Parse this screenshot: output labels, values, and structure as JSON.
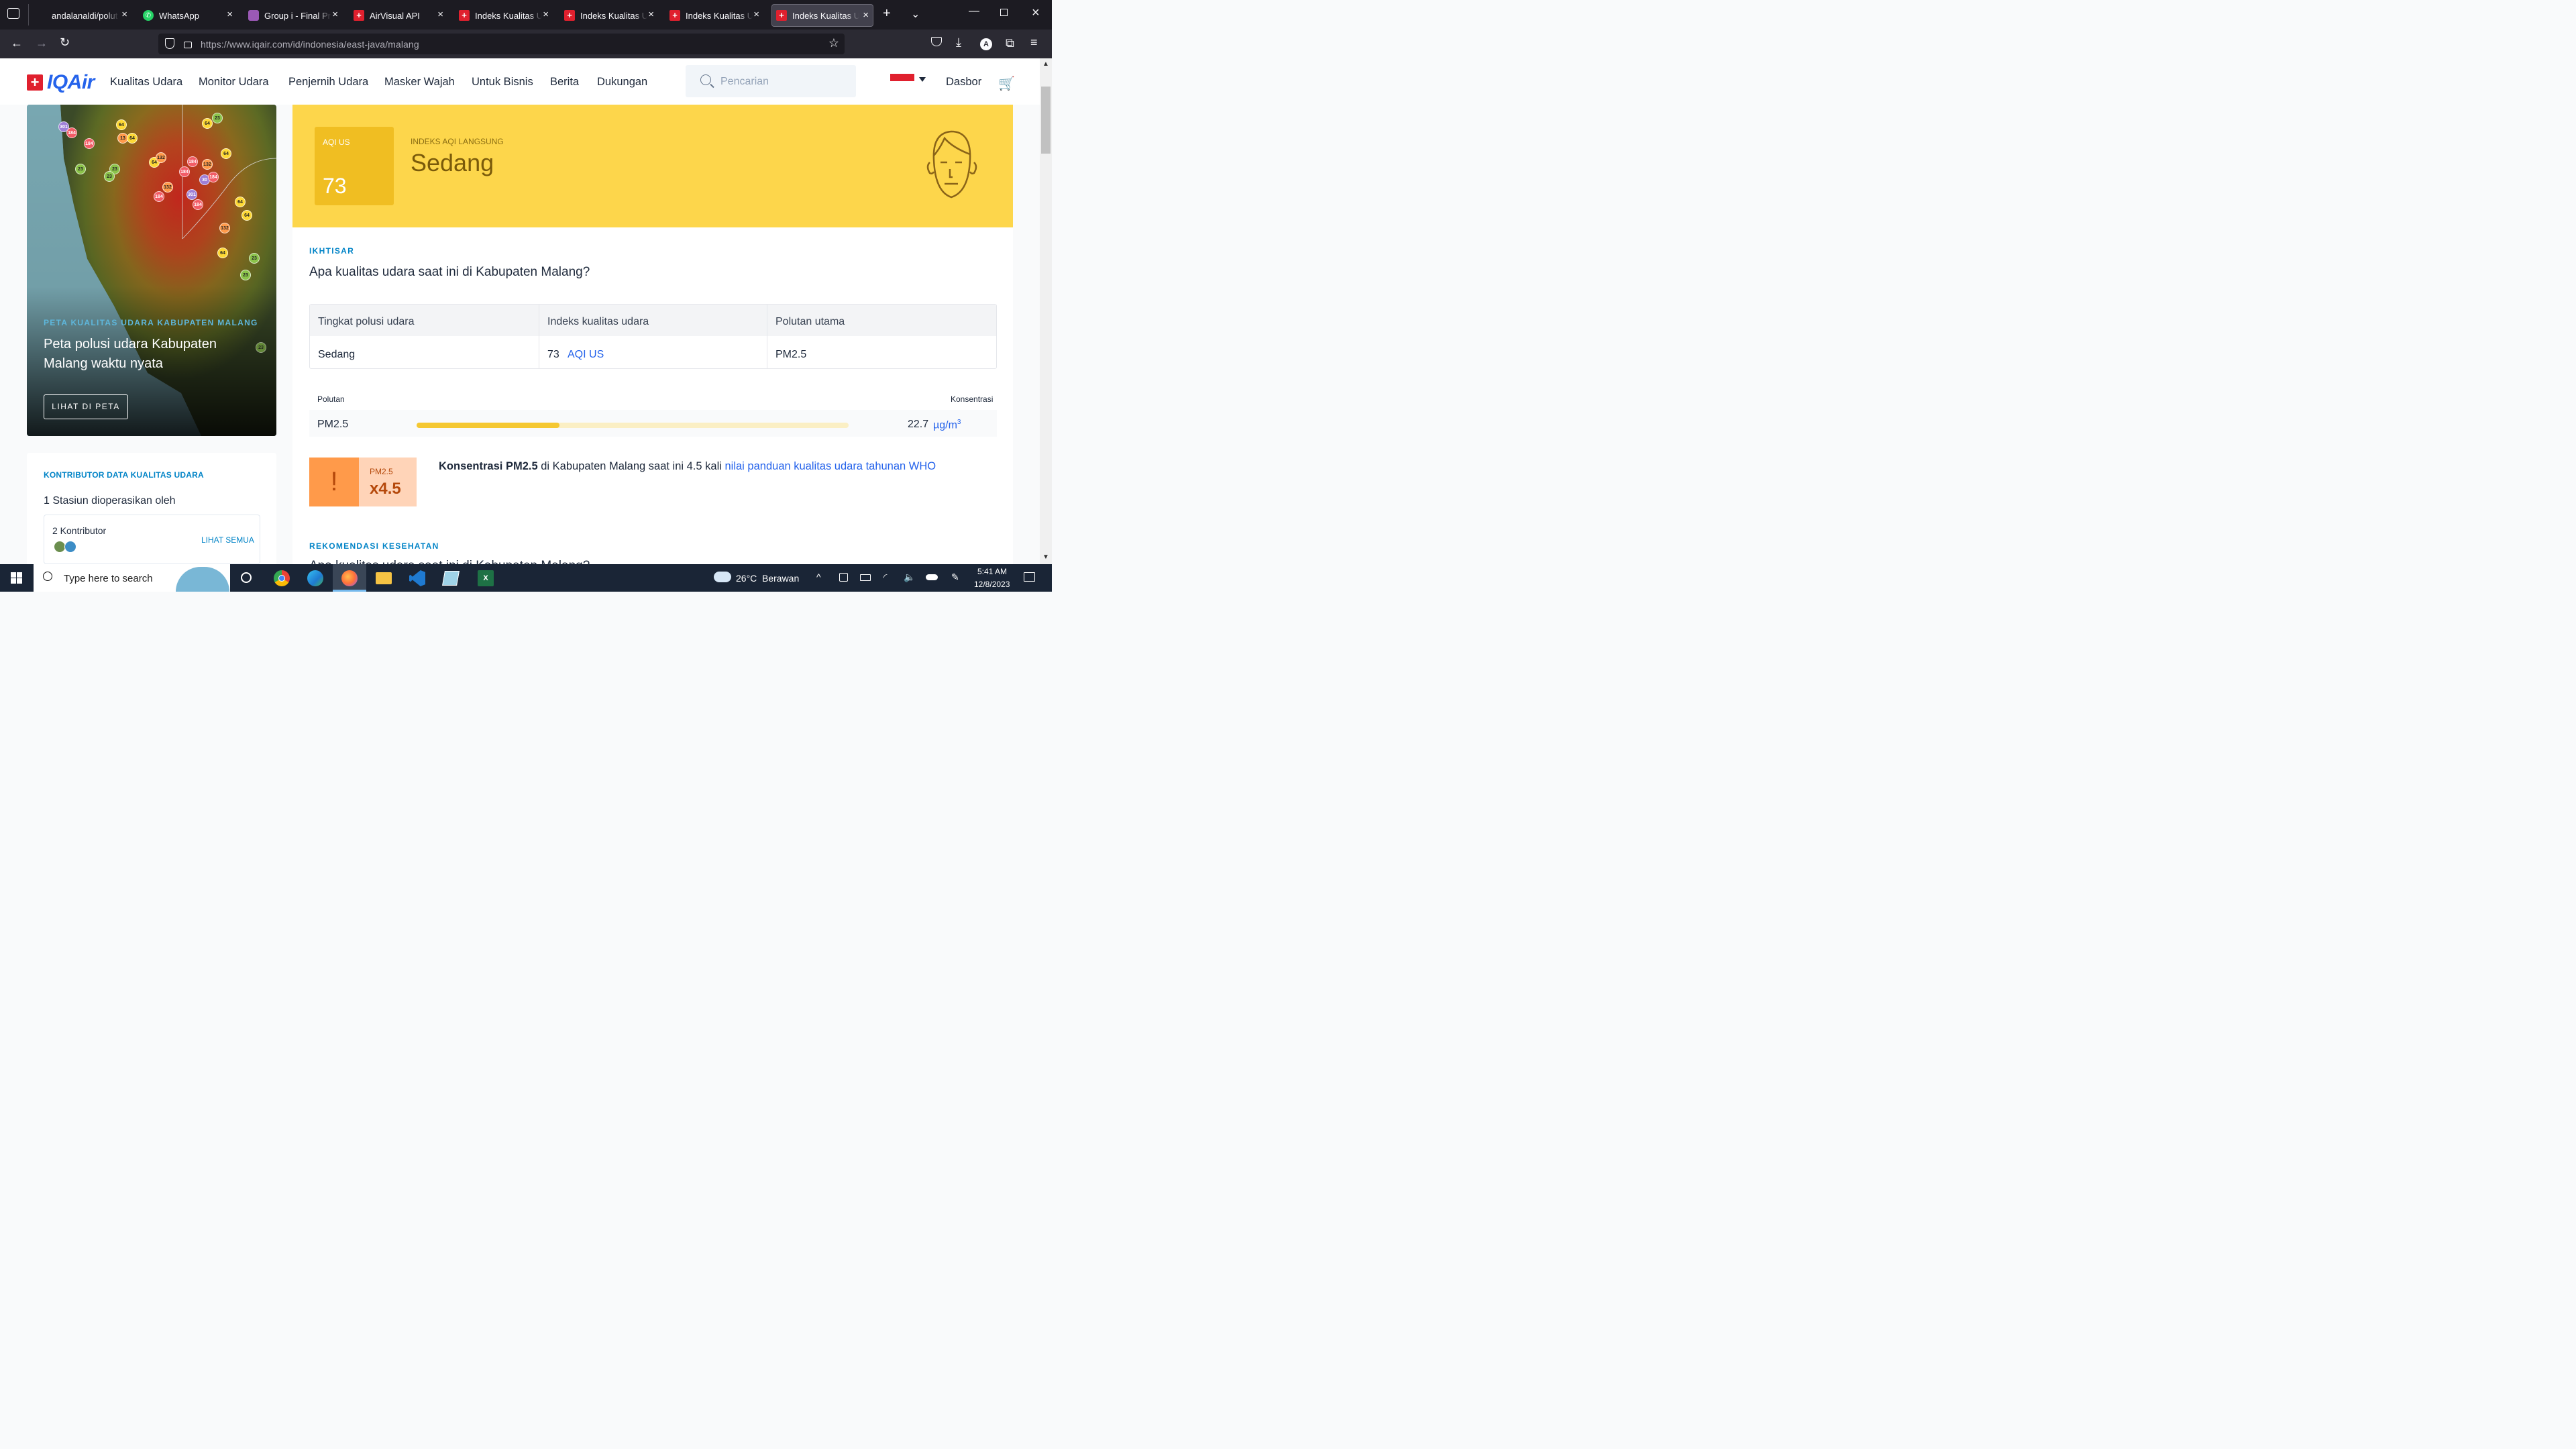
{
  "browser": {
    "tabs": [
      {
        "title": "andalanaldi/polut",
        "icon": "github-icon"
      },
      {
        "title": "WhatsApp",
        "icon": "whatsapp-icon"
      },
      {
        "title": "Group i - Final Pro",
        "icon": "trello-icon"
      },
      {
        "title": "AirVisual API",
        "icon": "iqair-icon"
      },
      {
        "title": "Indeks Kualitas Ud",
        "icon": "iqair-icon"
      },
      {
        "title": "Indeks Kualitas Ud",
        "icon": "iqair-icon"
      },
      {
        "title": "Indeks Kualitas Ud",
        "icon": "iqair-icon"
      },
      {
        "title": "Indeks Kualitas Ud",
        "icon": "iqair-icon",
        "active": true
      }
    ],
    "url": "https://www.iqair.com/id/indonesia/east-java/malang",
    "profile_initial": "A"
  },
  "site": {
    "logo_text": "IQAir",
    "nav": [
      "Kualitas Udara",
      "Monitor Udara",
      "Penjernih Udara",
      "Masker Wajah",
      "Untuk Bisnis",
      "Berita",
      "Dukungan"
    ],
    "search_placeholder": "Pencarian",
    "dashboard": "Dasbor"
  },
  "map_card": {
    "kicker": "PETA KUALITAS UDARA KABUPATEN MALANG",
    "title": "Peta polusi udara Kabupaten Malang waktu nyata",
    "button": "LIHAT DI PETA",
    "markers": [
      "301",
      "184",
      "184",
      "64",
      "13",
      "64",
      "23",
      "23",
      "23",
      "64",
      "132",
      "184",
      "132",
      "64",
      "184",
      "30",
      "184",
      "132",
      "301",
      "184",
      "64",
      "64",
      "184",
      "132",
      "64",
      "23",
      "23",
      "23",
      "64",
      "23"
    ]
  },
  "contributors": {
    "kicker": "KONTRIBUTOR DATA KUALITAS UDARA",
    "stations": "1 Stasiun dioperasikan oleh",
    "count": "2 Kontributor",
    "see_all": "LIHAT SEMUA"
  },
  "aqi": {
    "label": "AQI US",
    "value": "73",
    "live_label": "INDEKS AQI LANGSUNG",
    "status": "Sedang",
    "color": "#fdd64b"
  },
  "overview": {
    "kicker": "IKHTISAR",
    "question": "Apa kualitas udara saat ini di Kabupaten Malang?",
    "table": {
      "headers": [
        "Tingkat polusi udara",
        "Indeks kualitas udara",
        "Polutan utama"
      ],
      "level": "Sedang",
      "aqi_value": "73",
      "aqi_unit": "AQI US",
      "pollutant": "PM2.5"
    },
    "pollutant_header": "Polutan",
    "concentration_header": "Konsentrasi",
    "pollutant_name": "PM2.5",
    "pollutant_fill": 0.33,
    "concentration_value": "22.7",
    "concentration_unit": "µg/m",
    "concentration_sup": "3"
  },
  "who": {
    "badge_label": "PM2.5",
    "multiplier": "x4.5",
    "text_bold": "Konsentrasi PM2.5",
    "text_mid": " di Kabupaten Malang saat ini 4.5 kali ",
    "text_link": "nilai panduan kualitas udara tahunan WHO"
  },
  "health": {
    "kicker": "REKOMENDASI KESEHATAN",
    "question_partial": "Apa kualitas udara saat ini di Kabupaten Malang?"
  },
  "taskbar": {
    "search_placeholder": "Type here to search",
    "weather_temp": "26°C",
    "weather_text": "Berawan",
    "time": "5:41 AM",
    "date": "12/8/2023"
  }
}
